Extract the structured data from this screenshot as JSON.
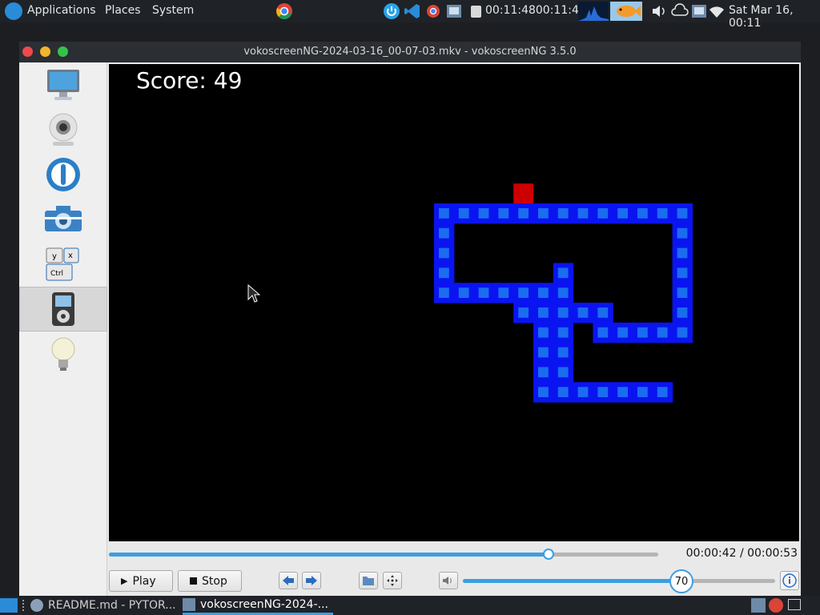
{
  "top_panel": {
    "menus": [
      "Applications",
      "Places",
      "System"
    ],
    "clock_text": "00:11:4800:11:48",
    "datetime": "Sat Mar 16, 00:11"
  },
  "window": {
    "title": "vokoscreenNG-2024-03-16_00-07-03.mkv - vokoscreenNG 3.5.0",
    "sidebar_items": [
      {
        "name": "screen-icon"
      },
      {
        "name": "webcam-icon"
      },
      {
        "name": "power-icon"
      },
      {
        "name": "camera-icon"
      },
      {
        "name": "keyboard-icon"
      },
      {
        "name": "media-player-icon"
      },
      {
        "name": "lightbulb-icon"
      }
    ],
    "active_sidebar_index": 5
  },
  "game": {
    "score_text": "Score: 49"
  },
  "player": {
    "seek_fraction": 0.8,
    "time_text": "00:00:42 / 00:00:53",
    "play_label": "Play",
    "stop_label": "Stop",
    "volume_value": "70",
    "volume_fraction": 0.7
  },
  "taskbar": {
    "tasks": [
      {
        "label": "README.md - PYTOR..."
      },
      {
        "label": "vokoscreenNG-2024-..."
      }
    ]
  },
  "colors": {
    "accent": "#3d9ee0",
    "snake_outer": "#0a14f0",
    "snake_inner": "#1a6cf0",
    "food": "#cc0000"
  }
}
